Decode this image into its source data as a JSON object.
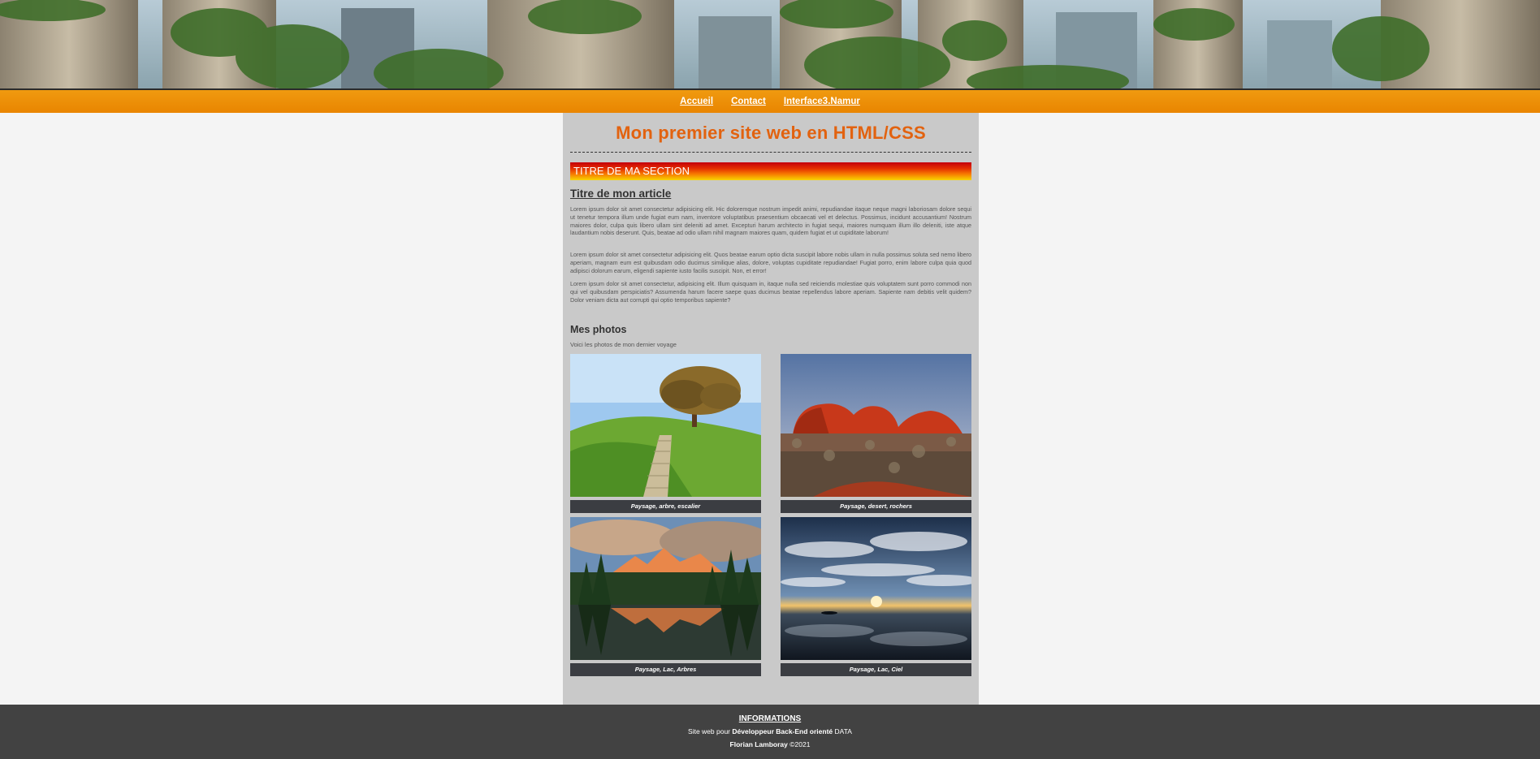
{
  "nav": {
    "items": [
      {
        "label": "Accueil"
      },
      {
        "label": "Contact"
      },
      {
        "label": "Interface3.Namur"
      }
    ]
  },
  "main": {
    "title": "Mon premier site web en HTML/CSS",
    "section_title": "TITRE DE MA SECTION",
    "article_title": "Titre de mon article",
    "paragraphs": [
      "Lorem ipsum dolor sit amet consectetur adipisicing elit. Hic doloremque nostrum impedit animi, repudiandae itaque neque magni laboriosam dolore sequi ut tenetur tempora illum unde fugiat eum nam, inventore voluptatibus praesentium obcaecati vel et delectus. Possimus, incidunt accusantium! Nostrum maiores dolor, culpa quis libero ullam sint deleniti ad amet. Excepturi harum architecto in fugiat sequi, maiores numquam illum illo deleniti, iste atque laudantium nobis deserunt. Quis, beatae ad odio ullam nihil magnam maiores quam, quidem fugiat et ut cupiditate laborum!",
      "Lorem ipsum dolor sit amet consectetur adipisicing elit. Quos beatae earum optio dicta suscipit labore nobis ullam in nulla possimus soluta sed nemo libero aperiam, magnam eum est quibusdam odio ducimus similique alias, dolore, voluptas cupiditate repudiandae! Fugiat porro, enim labore culpa quia quod adipisci dolorum earum, eligendi sapiente iusto facilis suscipit. Non, et error!",
      "Lorem ipsum dolor sit amet consectetur, adipisicing elit. Illum quisquam in, itaque nulla sed reiciendis molestiae quis voluptatem sunt porro commodi non qui vel quibusdam perspiciatis? Assumenda harum facere saepe quas ducimus beatae repellendus labore aperiam. Sapiente nam debitis velit quidem? Dolor veniam dicta aut corrupti qui optio temporibus sapiente?"
    ],
    "photos_title": "Mes photos",
    "photos_subtitle": "Voici les photos de mon dernier voyage",
    "photos": [
      {
        "caption": "Paysage, arbre, escalier"
      },
      {
        "caption": "Paysage, desert, rochers"
      },
      {
        "caption": "Paysage, Lac, Arbres"
      },
      {
        "caption": "Paysage, Lac, Ciel"
      }
    ]
  },
  "footer": {
    "title": "INFORMATIONS",
    "line1_prefix": "Site web pour",
    "line1_bold": "Développeur Back-End orienté",
    "line1_suffix": "DATA",
    "line2_bold": "Florian Lamboray",
    "line2_suffix": "©2021"
  }
}
